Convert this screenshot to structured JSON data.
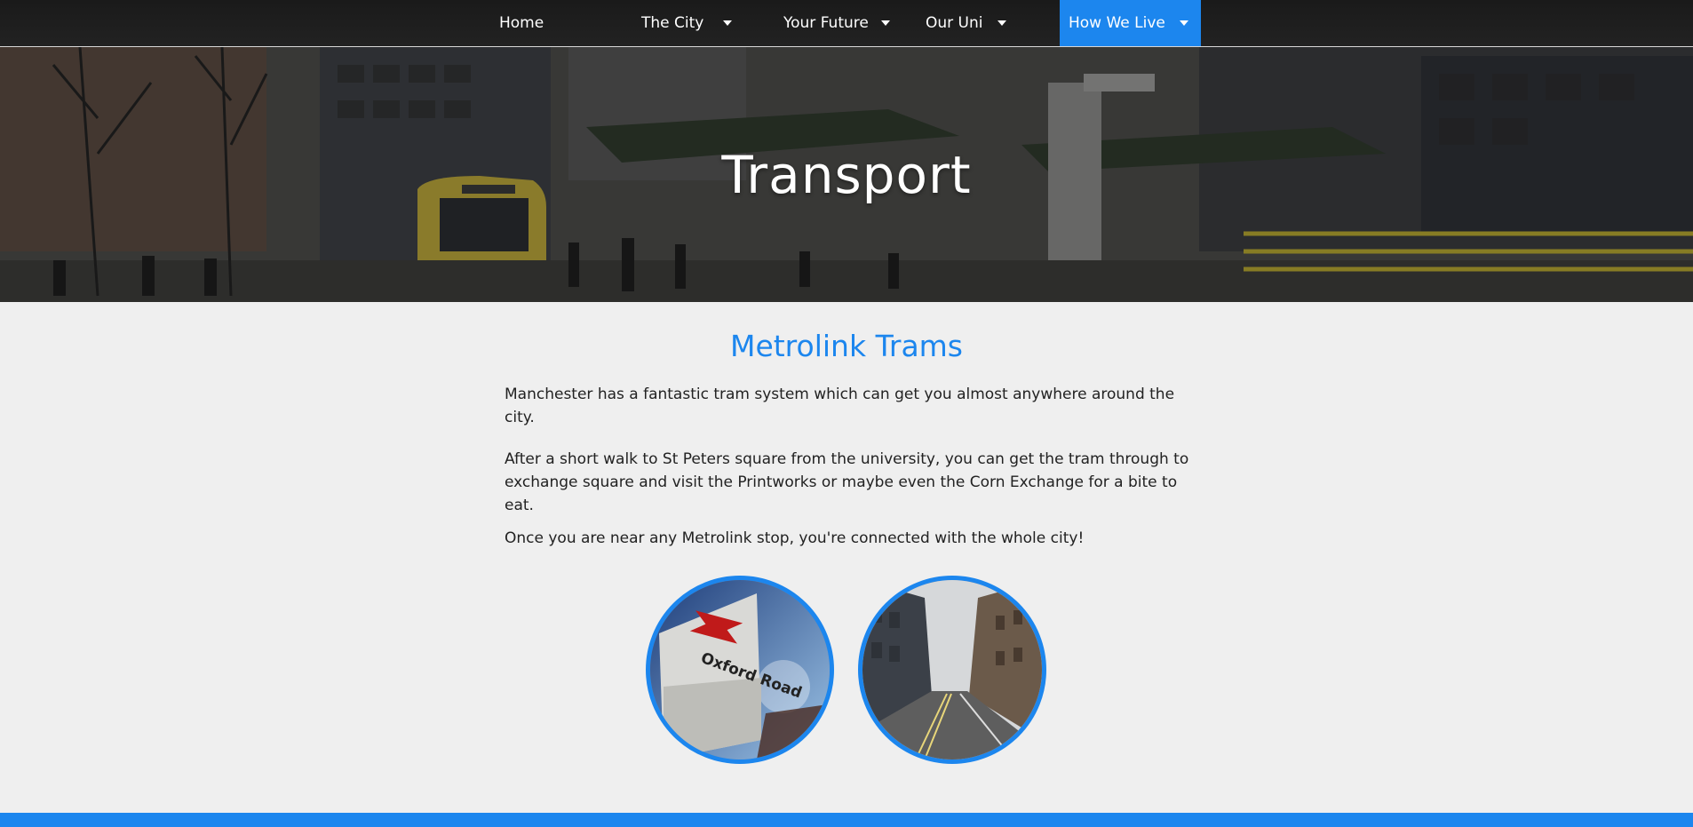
{
  "nav": {
    "items": [
      {
        "label": "Home",
        "has_dropdown": false,
        "active": false
      },
      {
        "label": "The City",
        "has_dropdown": true,
        "active": false
      },
      {
        "label": "Your Future",
        "has_dropdown": true,
        "active": false
      },
      {
        "label": "Our Uni",
        "has_dropdown": true,
        "active": false
      },
      {
        "label": "How We Live",
        "has_dropdown": true,
        "active": true
      }
    ],
    "dropdown_icon": "caret-down-icon"
  },
  "hero": {
    "title": "Transport"
  },
  "section": {
    "title": "Metrolink Trams",
    "paragraphs": [
      "Manchester has a fantastic tram system which can get you almost anywhere around the city.",
      "After a short walk to St Peters square from the university, you can get the tram through to exchange square and visit the Printworks or maybe even the Corn Exchange for a bite to eat.",
      "Once you are near any Metrolink stop, you're connected with the whole city!"
    ],
    "photos": [
      {
        "sign_text": "Oxford Road"
      },
      {
        "sign_text": ""
      }
    ]
  },
  "colors": {
    "accent": "#1c86ee",
    "background": "#efefef",
    "nav_background": "#1e1e1e",
    "text": "#222222"
  }
}
